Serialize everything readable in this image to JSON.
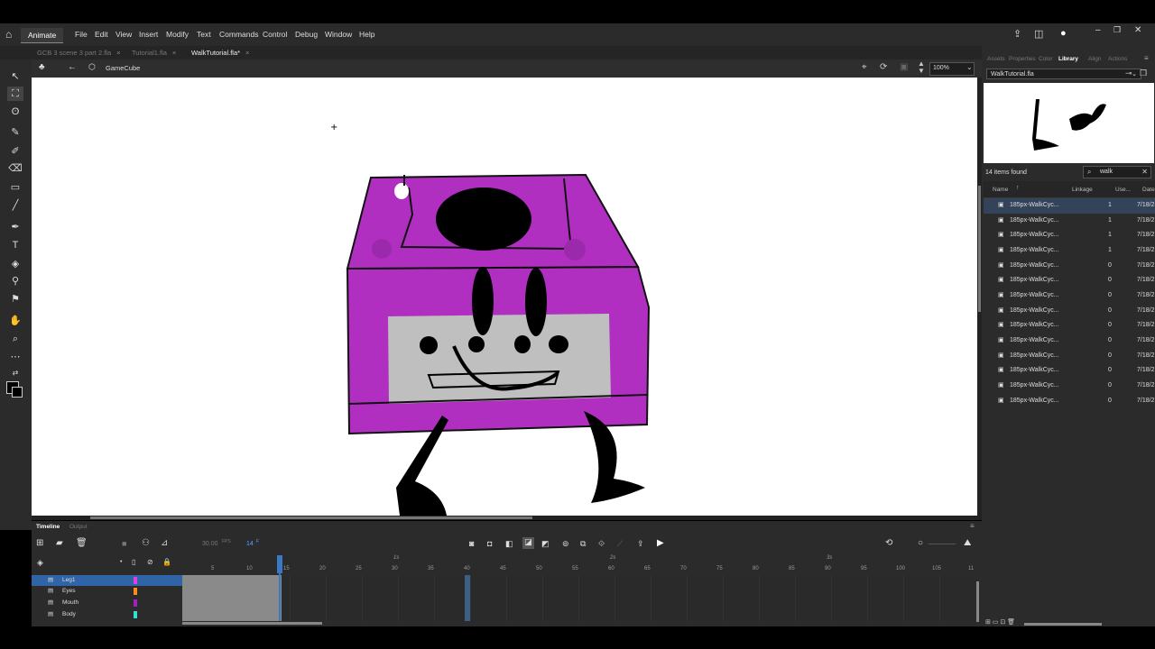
{
  "app": {
    "name": "Animate"
  },
  "menu": [
    "File",
    "Edit",
    "View",
    "Insert",
    "Modify",
    "Text",
    "Commands",
    "Control",
    "Debug",
    "Window",
    "Help"
  ],
  "tabs": [
    {
      "label": "GCB 3 scene 3 part 2.fla",
      "active": false
    },
    {
      "label": "Tutorial1.fla",
      "active": false
    },
    {
      "label": "WalkTutorial.fla*",
      "active": true
    }
  ],
  "editbar": {
    "symbol": "GameCube",
    "zoom": "100%"
  },
  "panel": {
    "tabs": [
      "Assets",
      "Properties",
      "Color",
      "Library",
      "Align",
      "Actions"
    ],
    "active_tab": "Library",
    "library_file": "WalkTutorial.fla",
    "items_found": "14 items found",
    "search_value": "walk",
    "columns": [
      "Name",
      "Linkage",
      "Use...",
      "Date"
    ],
    "items": [
      {
        "name": "185px-WalkCyc...",
        "use": "1",
        "date": "7/18/2"
      },
      {
        "name": "185px-WalkCyc...",
        "use": "1",
        "date": "7/18/2"
      },
      {
        "name": "185px-WalkCyc...",
        "use": "1",
        "date": "7/18/2"
      },
      {
        "name": "185px-WalkCyc...",
        "use": "1",
        "date": "7/18/2"
      },
      {
        "name": "185px-WalkCyc...",
        "use": "0",
        "date": "7/18/2"
      },
      {
        "name": "185px-WalkCyc...",
        "use": "0",
        "date": "7/18/2"
      },
      {
        "name": "185px-WalkCyc...",
        "use": "0",
        "date": "7/18/2"
      },
      {
        "name": "185px-WalkCyc...",
        "use": "0",
        "date": "7/18/2"
      },
      {
        "name": "185px-WalkCyc...",
        "use": "0",
        "date": "7/18/2"
      },
      {
        "name": "185px-WalkCyc...",
        "use": "0",
        "date": "7/18/2"
      },
      {
        "name": "185px-WalkCyc...",
        "use": "0",
        "date": "7/18/2"
      },
      {
        "name": "185px-WalkCyc...",
        "use": "0",
        "date": "7/18/2"
      },
      {
        "name": "185px-WalkCyc...",
        "use": "0",
        "date": "7/18/2"
      },
      {
        "name": "185px-WalkCyc...",
        "use": "0",
        "date": "7/18/2"
      }
    ]
  },
  "timeline": {
    "tabs": [
      "Timeline",
      "Output"
    ],
    "fps": "30.00",
    "fps_unit": "FPS",
    "current_frame": "14",
    "frame_unit": "F",
    "layers": [
      {
        "name": "Leg1",
        "color": "#e040e0",
        "selected": true
      },
      {
        "name": "Eyes",
        "color": "#ff8c1a",
        "selected": false
      },
      {
        "name": "Mouth",
        "color": "#a020c0",
        "selected": false
      },
      {
        "name": "Body",
        "color": "#30e0d0",
        "selected": false
      }
    ],
    "frame_numbers": [
      "5",
      "10",
      "15",
      "20",
      "25",
      "30",
      "35",
      "40",
      "45",
      "50",
      "55",
      "60",
      "65",
      "70",
      "75",
      "80",
      "85",
      "90",
      "95",
      "100",
      "105",
      "11"
    ],
    "seconds": [
      "1s",
      "2s",
      "3s"
    ]
  },
  "colors": {
    "body": "#b02fc0",
    "panel": "#2b2b2b",
    "accent": "#2f65a6"
  }
}
